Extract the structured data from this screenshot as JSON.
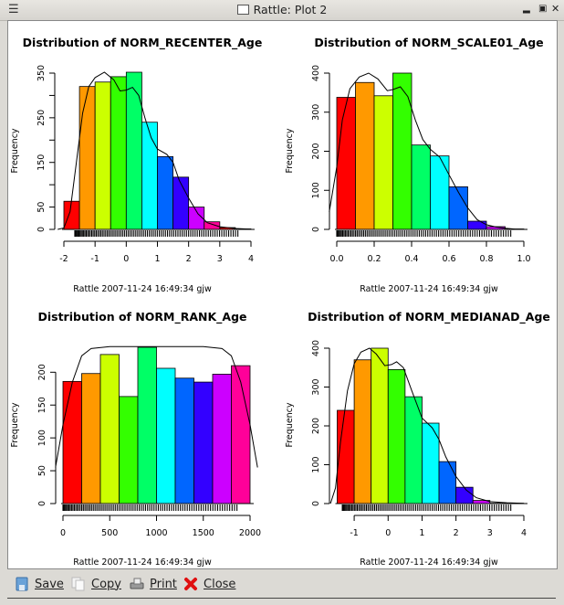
{
  "window": {
    "title": "Rattle: Plot 2",
    "menu_icon": "menu-icon",
    "controls": [
      "minimize-icon",
      "maximize-icon",
      "close-icon"
    ]
  },
  "toolbar": {
    "buttons": [
      {
        "label": "Save",
        "icon": "save-icon"
      },
      {
        "label": "Copy",
        "icon": "copy-icon"
      },
      {
        "label": "Print",
        "icon": "print-icon"
      },
      {
        "label": "Close",
        "icon": "close-icon"
      }
    ]
  },
  "palette": [
    "#FF0000",
    "#FF9900",
    "#CCFF00",
    "#33FF00",
    "#00FF66",
    "#00FFFF",
    "#0066FF",
    "#3300FF",
    "#CC00FF",
    "#FF0099",
    "#FF0000",
    "#FF9900"
  ],
  "chart_data": [
    {
      "type": "bar",
      "title": "Distribution of NORM_RECENTER_Age",
      "xlabel": "",
      "ylabel": "Frequency",
      "subtitle": "Rattle 2007-11-24 16:49:34 gjw",
      "bin_edges": [
        -2,
        -1.5,
        -1,
        -0.5,
        0,
        0.5,
        1,
        1.5,
        2,
        2.5,
        3,
        3.5,
        4
      ],
      "values": [
        63,
        320,
        330,
        342,
        352,
        240,
        163,
        117,
        50,
        17,
        4,
        1
      ],
      "xlim": [
        -2,
        4
      ],
      "ylim": [
        0,
        350
      ],
      "xticks": [
        "-2",
        "-1",
        "0",
        "1",
        "2",
        "3",
        "4"
      ],
      "xtick_values": [
        -2,
        -1,
        0,
        1,
        2,
        3,
        4
      ],
      "yticks": [
        "0",
        "50",
        "150",
        "250",
        "350"
      ],
      "ytick_values": [
        0,
        50,
        100,
        150,
        200,
        250,
        300,
        350
      ],
      "ytick_labels_all": [
        "0",
        "50",
        "",
        "150",
        "",
        "250",
        "",
        "350"
      ],
      "density": [
        [
          -2.2,
          0
        ],
        [
          -2,
          3
        ],
        [
          -1.8,
          40
        ],
        [
          -1.6,
          150
        ],
        [
          -1.4,
          260
        ],
        [
          -1.2,
          320
        ],
        [
          -1,
          340
        ],
        [
          -0.7,
          352
        ],
        [
          -0.4,
          335
        ],
        [
          -0.2,
          310
        ],
        [
          0,
          312
        ],
        [
          0.2,
          318
        ],
        [
          0.4,
          300
        ],
        [
          0.6,
          250
        ],
        [
          0.8,
          205
        ],
        [
          1,
          180
        ],
        [
          1.3,
          168
        ],
        [
          1.5,
          150
        ],
        [
          1.7,
          110
        ],
        [
          2,
          70
        ],
        [
          2.3,
          35
        ],
        [
          2.6,
          15
        ],
        [
          3,
          6
        ],
        [
          3.5,
          2
        ],
        [
          4,
          0.5
        ]
      ],
      "grid": false
    },
    {
      "type": "bar",
      "title": "Distribution of NORM_SCALE01_Age",
      "xlabel": "",
      "ylabel": "Frequency",
      "subtitle": "Rattle 2007-11-24 16:49:34 gjw",
      "bin_edges": [
        0,
        0.1,
        0.2,
        0.3,
        0.4,
        0.5,
        0.6,
        0.7,
        0.8,
        0.9,
        1.0
      ],
      "values": [
        338,
        376,
        342,
        400,
        216,
        188,
        109,
        21,
        7,
        1
      ],
      "xlim": [
        0,
        1
      ],
      "ylim": [
        0,
        400
      ],
      "xticks": [
        "0.0",
        "0.2",
        "0.4",
        "0.6",
        "0.8",
        "1.0"
      ],
      "xtick_values": [
        0,
        0.2,
        0.4,
        0.6,
        0.8,
        1.0
      ],
      "ytick_values": [
        0,
        100,
        200,
        300,
        400
      ],
      "ytick_labels_all": [
        "0",
        "100",
        "200",
        "300",
        "400"
      ],
      "density": [
        [
          -0.04,
          45
        ],
        [
          0,
          160
        ],
        [
          0.03,
          280
        ],
        [
          0.07,
          360
        ],
        [
          0.12,
          390
        ],
        [
          0.17,
          400
        ],
        [
          0.22,
          385
        ],
        [
          0.27,
          355
        ],
        [
          0.3,
          358
        ],
        [
          0.34,
          365
        ],
        [
          0.38,
          340
        ],
        [
          0.42,
          280
        ],
        [
          0.46,
          230
        ],
        [
          0.5,
          205
        ],
        [
          0.55,
          185
        ],
        [
          0.6,
          140
        ],
        [
          0.65,
          95
        ],
        [
          0.7,
          55
        ],
        [
          0.75,
          25
        ],
        [
          0.8,
          12
        ],
        [
          0.85,
          6
        ],
        [
          0.9,
          3
        ],
        [
          0.95,
          1
        ],
        [
          1,
          0.3
        ]
      ],
      "grid": false
    },
    {
      "type": "bar",
      "title": "Distribution of NORM_RANK_Age",
      "xlabel": "",
      "ylabel": "Frequency",
      "subtitle": "Rattle 2007-11-24 16:49:34 gjw",
      "bin_edges": [
        0,
        200,
        400,
        600,
        800,
        1000,
        1200,
        1400,
        1600,
        1800,
        2000
      ],
      "values": [
        186,
        198,
        227,
        163,
        238,
        206,
        191,
        185,
        197,
        210
      ],
      "xlim": [
        0,
        2000
      ],
      "ylim": [
        0,
        238
      ],
      "xticks": [
        "0",
        "500",
        "1000",
        "1500",
        "2000"
      ],
      "xtick_values": [
        0,
        500,
        1000,
        1500,
        2000
      ],
      "ytick_values": [
        0,
        50,
        100,
        150,
        200
      ],
      "ytick_labels_all": [
        "0",
        "50",
        "100",
        "150",
        "200"
      ],
      "density": [
        [
          -80,
          55
        ],
        [
          0,
          120
        ],
        [
          100,
          185
        ],
        [
          200,
          225
        ],
        [
          300,
          236
        ],
        [
          500,
          239
        ],
        [
          1000,
          239
        ],
        [
          1500,
          239
        ],
        [
          1700,
          236
        ],
        [
          1800,
          225
        ],
        [
          1900,
          185
        ],
        [
          2000,
          120
        ],
        [
          2080,
          55
        ]
      ],
      "grid": false
    },
    {
      "type": "bar",
      "title": "Distribution of NORM_MEDIANAD_Age",
      "xlabel": "",
      "ylabel": "Frequency",
      "subtitle": "Rattle 2007-11-24 16:49:34 gjw",
      "bin_edges": [
        -1.5,
        -1,
        -0.5,
        0,
        0.5,
        1,
        1.5,
        2,
        2.5,
        3,
        3.5,
        4
      ],
      "values": [
        240,
        370,
        400,
        345,
        275,
        207,
        108,
        42,
        8,
        1,
        0.5
      ],
      "xlim": [
        -1.5,
        4
      ],
      "ylim": [
        0,
        400
      ],
      "xticks": [
        "-1",
        "0",
        "1",
        "2",
        "3",
        "4"
      ],
      "xtick_values": [
        -1,
        0,
        1,
        2,
        3,
        4
      ],
      "ytick_values": [
        0,
        100,
        200,
        300,
        400
      ],
      "ytick_labels_all": [
        "0",
        "100",
        "200",
        "300",
        "400"
      ],
      "density": [
        [
          -1.7,
          0
        ],
        [
          -1.55,
          40
        ],
        [
          -1.4,
          160
        ],
        [
          -1.2,
          290
        ],
        [
          -1,
          360
        ],
        [
          -0.8,
          390
        ],
        [
          -0.55,
          400
        ],
        [
          -0.35,
          385
        ],
        [
          -0.1,
          355
        ],
        [
          0.1,
          358
        ],
        [
          0.25,
          365
        ],
        [
          0.45,
          350
        ],
        [
          0.7,
          290
        ],
        [
          1,
          220
        ],
        [
          1.3,
          195
        ],
        [
          1.5,
          165
        ],
        [
          1.7,
          120
        ],
        [
          2,
          70
        ],
        [
          2.3,
          35
        ],
        [
          2.6,
          15
        ],
        [
          3,
          5
        ],
        [
          3.5,
          2
        ],
        [
          4,
          0.5
        ]
      ],
      "grid": false
    }
  ]
}
